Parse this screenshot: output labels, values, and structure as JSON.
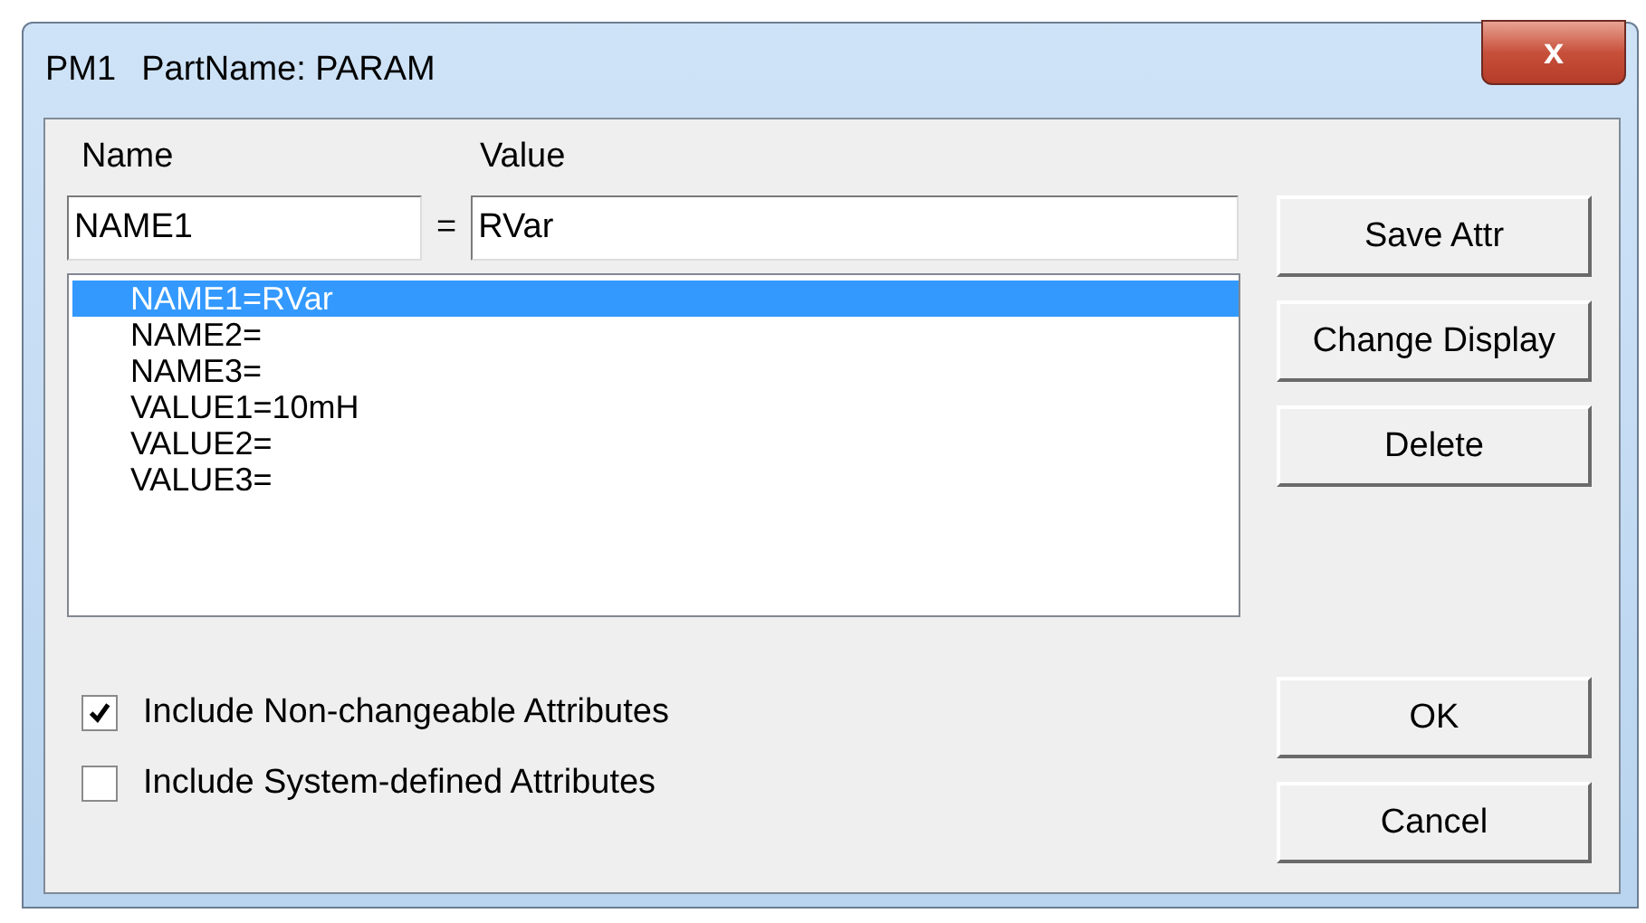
{
  "window": {
    "title_id": "PM1",
    "title": "PartName: PARAM",
    "close": "x"
  },
  "labels": {
    "name": "Name",
    "value": "Value"
  },
  "name_field": {
    "value": "NAME1"
  },
  "equals": "=",
  "value_field": {
    "value": "RVar"
  },
  "attributes": [
    {
      "text": "NAME1=RVar",
      "selected": true
    },
    {
      "text": "NAME2=",
      "selected": false
    },
    {
      "text": "NAME3=",
      "selected": false
    },
    {
      "text": "VALUE1=10mH",
      "selected": false
    },
    {
      "text": "VALUE2=",
      "selected": false
    },
    {
      "text": "VALUE3=",
      "selected": false
    }
  ],
  "side_buttons": [
    "Save Attr",
    "Change Display",
    "Delete"
  ],
  "options": [
    {
      "label": "Include Non-changeable Attributes",
      "checked": true
    },
    {
      "label": "Include System-defined Attributes",
      "checked": false
    }
  ],
  "dialog_buttons": [
    "OK",
    "Cancel"
  ]
}
